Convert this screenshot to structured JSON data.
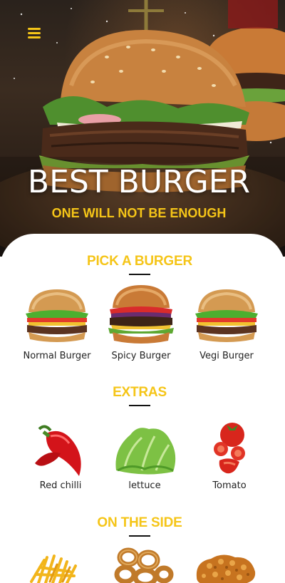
{
  "hero": {
    "title": "BEST BURGER",
    "subtitle": "ONE WILL NOT BE ENOUGH",
    "menu_icon": "hamburger-menu-icon"
  },
  "sections": {
    "burgers": {
      "title": "PICK A BURGER",
      "items": [
        {
          "label": "Normal Burger",
          "icon": "burger-icon"
        },
        {
          "label": "Spicy Burger",
          "icon": "burger-icon"
        },
        {
          "label": "Vegi Burger",
          "icon": "burger-icon"
        }
      ]
    },
    "extras": {
      "title": "EXTRAS",
      "items": [
        {
          "label": "Red chilli",
          "icon": "chilli-icon"
        },
        {
          "label": "lettuce",
          "icon": "lettuce-icon"
        },
        {
          "label": "Tomato",
          "icon": "tomato-icon"
        }
      ]
    },
    "sides": {
      "title": "ON THE SIDE",
      "items": [
        {
          "icon": "fries-icon"
        },
        {
          "icon": "onion-rings-icon"
        },
        {
          "icon": "fried-chicken-icon"
        }
      ]
    }
  },
  "colors": {
    "accent": "#f5c518",
    "text": "#222222",
    "hero_bg": "#2a221c"
  }
}
